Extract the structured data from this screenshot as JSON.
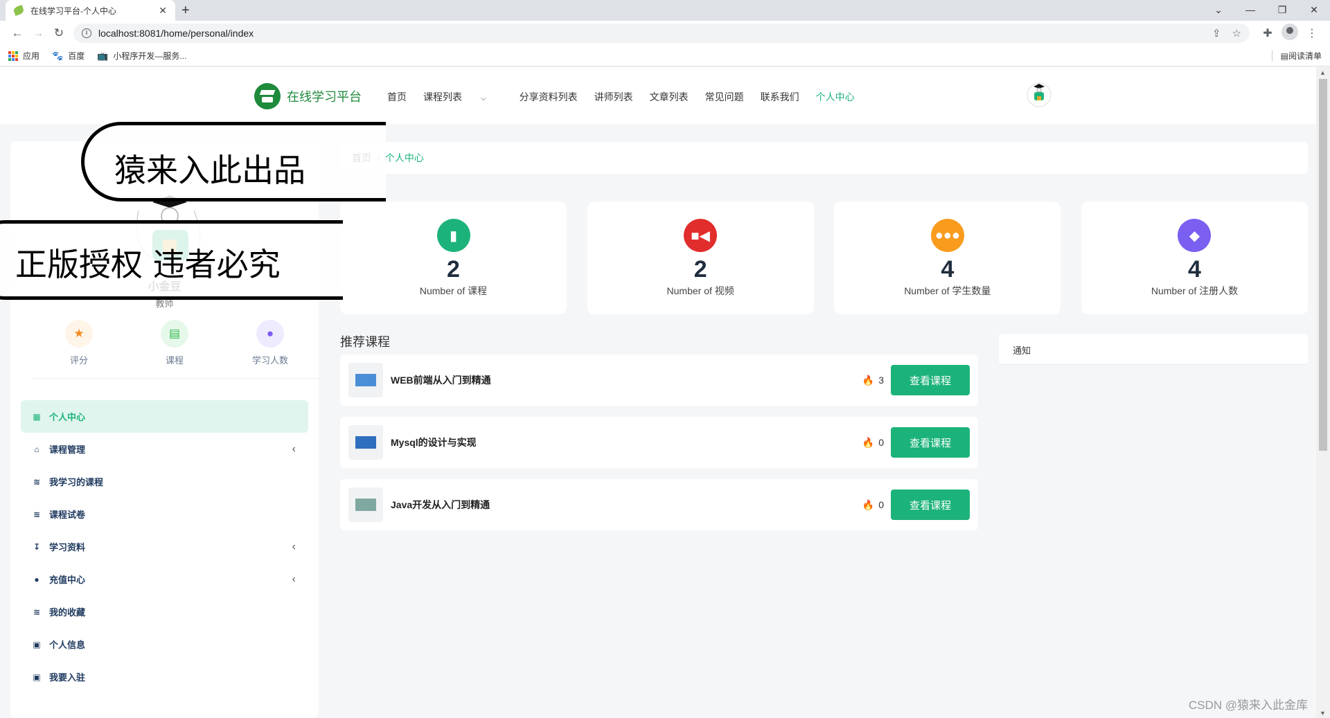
{
  "browser": {
    "tab_title": "在线学习平台-个人中心",
    "url": "localhost:8081/home/personal/index",
    "bookmarks": [
      {
        "label": "应用",
        "icon": "apps-grid-icon"
      },
      {
        "label": "百度",
        "icon": "baidu-paw-icon"
      },
      {
        "label": "小程序开发—服务...",
        "icon": "bilibili-tv-icon"
      }
    ],
    "reading_list": "阅读清单"
  },
  "header": {
    "logo_text": "在线学习平台",
    "nav": [
      {
        "label": "首页"
      },
      {
        "label": "课程列表",
        "has_dropdown": true
      },
      {
        "label": "分享资料列表"
      },
      {
        "label": "讲师列表"
      },
      {
        "label": "文章列表"
      },
      {
        "label": "常见问题"
      },
      {
        "label": "联系我们"
      },
      {
        "label": "个人中心",
        "active": true
      }
    ]
  },
  "profile": {
    "name": "小金豆",
    "role": "教师",
    "stats": [
      {
        "label": "评分",
        "icon": "star-icon",
        "color": "#f58a1f",
        "bg": "#fff4e8"
      },
      {
        "label": "课程",
        "icon": "document-icon",
        "color": "#2db84d",
        "bg": "#e6f8ea"
      },
      {
        "label": "学习人数",
        "icon": "user-icon",
        "color": "#7b5cf0",
        "bg": "#efebff"
      }
    ]
  },
  "sidebar": {
    "items": [
      {
        "label": "个人中心",
        "icon": "grid-icon",
        "active": true
      },
      {
        "label": "课程管理",
        "icon": "basket-icon",
        "expandable": true
      },
      {
        "label": "我学习的课程",
        "icon": "layers-icon"
      },
      {
        "label": "课程试卷",
        "icon": "layers-icon"
      },
      {
        "label": "学习资料",
        "icon": "download-arrow-icon",
        "expandable": true
      },
      {
        "label": "充值中心",
        "icon": "user-icon",
        "expandable": true
      },
      {
        "label": "我的收藏",
        "icon": "layers-icon"
      },
      {
        "label": "个人信息",
        "icon": "id-card-icon"
      },
      {
        "label": "我要入驻",
        "icon": "id-card-icon"
      }
    ]
  },
  "breadcrumb": {
    "home": "首页",
    "separator": "/",
    "current": "个人中心"
  },
  "stat_cards": [
    {
      "value": "2",
      "label": "Number of 课程",
      "icon": "book-icon",
      "color": "#1cb37a"
    },
    {
      "value": "2",
      "label": "Number of 视频",
      "icon": "video-camera-icon",
      "color": "#e22d2d"
    },
    {
      "value": "4",
      "label": "Number of 学生数量",
      "icon": "users-group-icon",
      "color": "#f99b1c"
    },
    {
      "value": "4",
      "label": "Number of 注册人数",
      "icon": "diamond-icon",
      "color": "#7a5ff0"
    }
  ],
  "recommended": {
    "title": "推荐课程",
    "button_label": "查看课程",
    "courses": [
      {
        "name": "WEB前端从入门到精通",
        "hot": "3",
        "thumb_color": "#4a8ed6"
      },
      {
        "name": "Mysql的设计与实现",
        "hot": "0",
        "thumb_color": "#2f6fbf"
      },
      {
        "name": "Java开发从入门到精通",
        "hot": "0",
        "thumb_color": "#7fa9a0"
      }
    ]
  },
  "notice": {
    "title": "通知"
  },
  "watermark": {
    "line1": "猿来入此出品",
    "line2": "正版授权 违者必究",
    "csdn": "CSDN @猿来入此金库"
  },
  "colors": {
    "accent": "#1cb37a",
    "logo_green": "#1e8a3c",
    "menu_text": "#1f3a5f"
  }
}
